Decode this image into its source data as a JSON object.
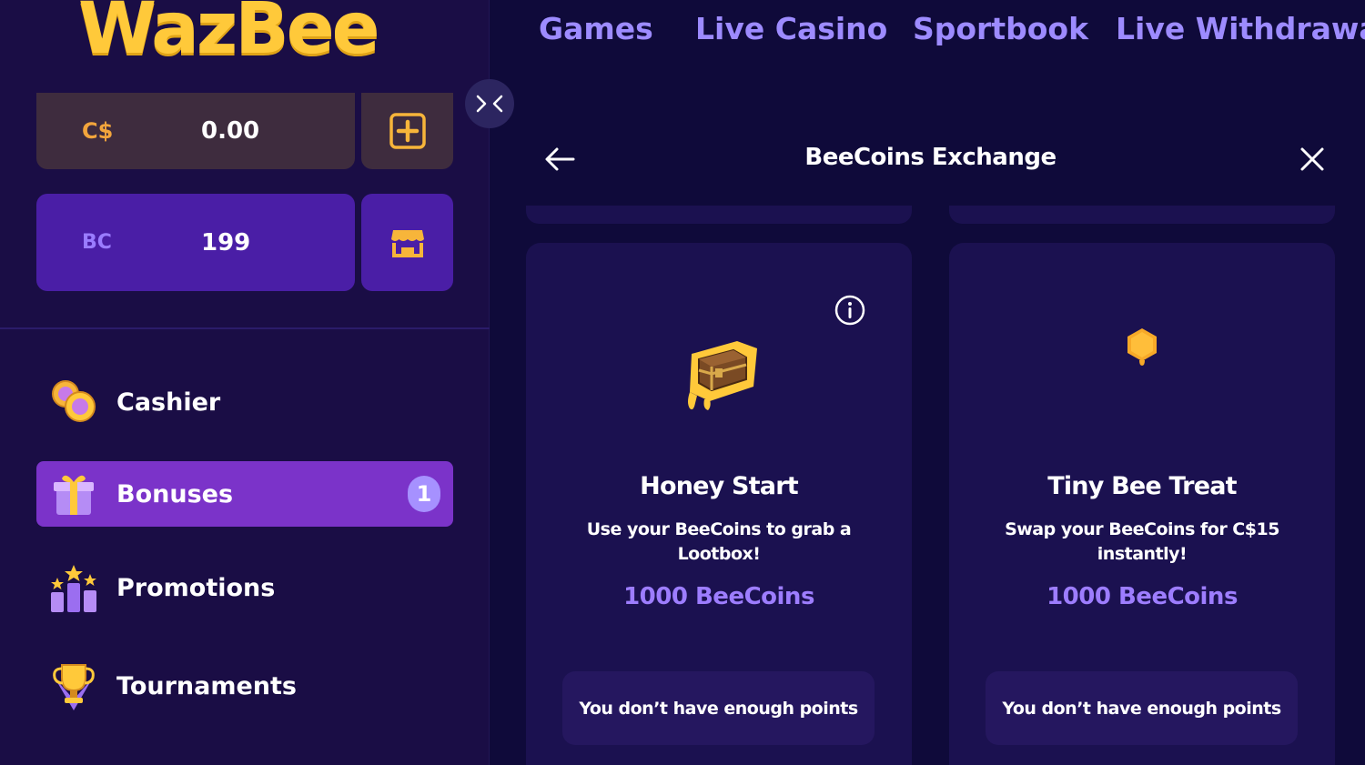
{
  "brand": {
    "logo_text": "WazBee"
  },
  "topnav": {
    "links": [
      "Games",
      "Live Casino",
      "Sportbook",
      "Live Withdrawal"
    ]
  },
  "balances": {
    "cash": {
      "currency": "C$",
      "value": "0.00",
      "action_icon": "plus-square-icon"
    },
    "beecoins": {
      "currency": "BC",
      "value": "199",
      "action_icon": "shop-icon"
    }
  },
  "sidebar": {
    "items": [
      {
        "label": "Cashier",
        "icon": "coins-icon"
      },
      {
        "label": "Bonuses",
        "icon": "gift-icon",
        "badge": "1",
        "active": true
      },
      {
        "label": "Promotions",
        "icon": "podium-stars-icon"
      },
      {
        "label": "Tournaments",
        "icon": "trophy-icon"
      }
    ]
  },
  "panel": {
    "title": "BeeCoins Exchange",
    "cards": [
      {
        "title": "Honey Start",
        "description": "Use your BeeCoins to grab a Lootbox!",
        "price": "1000 BeeCoins",
        "button": "You don’t have enough points",
        "icon": "treasure-chest-icon"
      },
      {
        "title": "Tiny Bee Treat",
        "description": "Swap your BeeCoins for C$15 instantly!",
        "price": "1000 BeeCoins",
        "button": "You don’t have enough points",
        "icon": "honeycomb-icon"
      }
    ]
  },
  "colors": {
    "background": "#0f0a3a",
    "sidebar": "#1a0d45",
    "accent_purple": "#9d8bff",
    "active_nav": "#7b33c9",
    "gold": "#ffc93a"
  }
}
